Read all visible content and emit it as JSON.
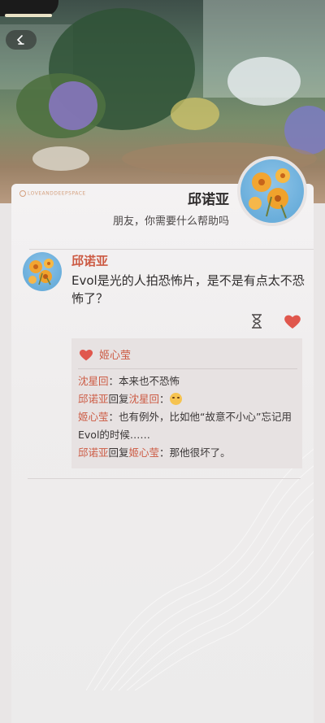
{
  "header": {
    "name": "邱诺亚",
    "subtitle": "朋友，你需要什么帮助吗",
    "watermark": "LOVEANDDEEPSPACE"
  },
  "post": {
    "author": "邱诺亚",
    "text": "Evol是光的人拍恐怖片，是不是有点太不恐怖了？",
    "liked": true
  },
  "comments": {
    "likes": [
      "姬心莹"
    ],
    "entries": [
      {
        "user": "沈星回",
        "reply_to": "",
        "separator": "：",
        "text": "本来也不恐怖",
        "emoji": false
      },
      {
        "user": "邱诺亚",
        "reply_word": "回复",
        "reply_to": "沈星回",
        "separator": "：",
        "text": "",
        "emoji": true
      },
      {
        "user": "姬心莹",
        "reply_to": "",
        "separator": "：",
        "text": "也有例外，比如他“故意不小心”忘记用Evol的时候……",
        "emoji": false
      },
      {
        "user": "邱诺亚",
        "reply_word": "回复",
        "reply_to": "姬心莹",
        "separator": "：",
        "text": "那他很坏了。",
        "emoji": false
      }
    ]
  },
  "colors": {
    "accent": "#cc5a43",
    "heart": "#e0574d",
    "card_bg": "#efeded"
  },
  "icons": {
    "back": "back-chevron-icon",
    "hourglass": "hourglass-icon",
    "like": "heart-icon"
  }
}
